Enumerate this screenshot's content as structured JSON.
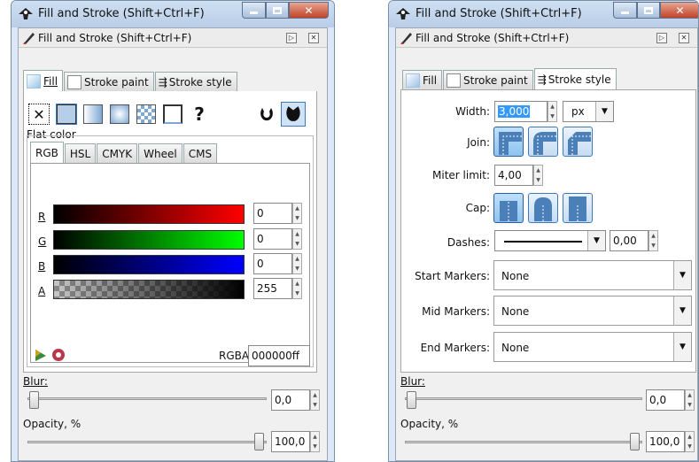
{
  "left": {
    "title": "Fill and Stroke (Shift+Ctrl+F)",
    "dock_title": "Fill and Stroke (Shift+Ctrl+F)",
    "tabs": [
      "Fill",
      "Stroke paint",
      "Stroke style"
    ],
    "paint_modes": [
      "no-paint",
      "flat-color",
      "linear-gradient",
      "radial-gradient",
      "pattern",
      "swatch",
      "unset"
    ],
    "unset_glyph": "?",
    "section_label": "Flat color",
    "color_tabs": [
      "RGB",
      "HSL",
      "CMYK",
      "Wheel",
      "CMS"
    ],
    "channels": [
      {
        "label": "R",
        "value": "0",
        "color": "#ff0000"
      },
      {
        "label": "G",
        "value": "0",
        "color": "#00ff00"
      },
      {
        "label": "B",
        "value": "0",
        "color": "#0000ff"
      },
      {
        "label": "A",
        "value": "255",
        "color": "#000000"
      }
    ],
    "rgba_label": "RGBA:",
    "rgba_value": "000000ff",
    "blur_label": "Blur:",
    "blur_value": "0,0",
    "opacity_label": "Opacity, %",
    "opacity_value": "100,0"
  },
  "right": {
    "title": "Fill and Stroke (Shift+Ctrl+F)",
    "dock_title": "Fill and Stroke (Shift+Ctrl+F)",
    "tabs": [
      "Fill",
      "Stroke paint",
      "Stroke style"
    ],
    "width_label": "Width:",
    "width_value": "3,000",
    "unit": "px",
    "join_label": "Join:",
    "miter_label": "Miter limit:",
    "miter_value": "4,00",
    "cap_label": "Cap:",
    "dashes_label": "Dashes:",
    "dash_offset": "0,00",
    "start_markers_label": "Start Markers:",
    "start_markers_value": "None",
    "mid_markers_label": "Mid Markers:",
    "mid_markers_value": "None",
    "end_markers_label": "End Markers:",
    "end_markers_value": "None",
    "blur_label": "Blur:",
    "blur_value": "0,0",
    "opacity_label": "Opacity, %",
    "opacity_value": "100,0"
  },
  "colors": {
    "accent": "#3f78c0",
    "selection": "#3399ff",
    "titlebar": "#b9cde6",
    "close": "#c0432a"
  }
}
